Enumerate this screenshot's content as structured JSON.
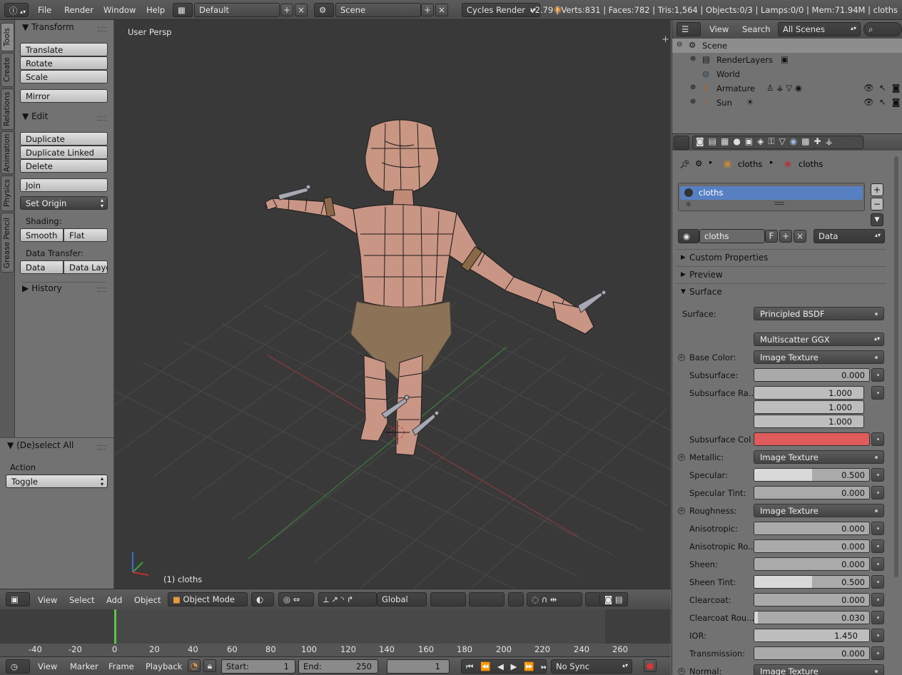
{
  "topbar": {
    "menus": [
      "File",
      "Render",
      "Window",
      "Help"
    ],
    "layout": "Default",
    "scene": "Scene",
    "engine": "Cycles Render",
    "stats": "v2.79 | Verts:831 | Faces:782 | Tris:1,564 | Objects:0/3 | Lamps:0/0 | Mem:71.94M | cloths"
  },
  "tabs": [
    "Tools",
    "Create",
    "Relations",
    "Animation",
    "Physics",
    "Grease Pencil"
  ],
  "toolshelf": {
    "transform": {
      "title": "Transform",
      "buttons": [
        "Translate",
        "Rotate",
        "Scale",
        "Mirror"
      ]
    },
    "edit": {
      "title": "Edit",
      "buttons": [
        "Duplicate",
        "Duplicate Linked",
        "Delete",
        "Join"
      ],
      "set_origin": "Set Origin"
    },
    "shading": {
      "label": "Shading:",
      "smooth": "Smooth",
      "flat": "Flat"
    },
    "data_transfer": {
      "label": "Data Transfer:",
      "data": "Data",
      "data_layout": "Data Layo"
    },
    "history": "History"
  },
  "operator": {
    "title": "(De)select All",
    "action_label": "Action",
    "action_value": "Toggle"
  },
  "viewport": {
    "view_name": "User Persp",
    "object_label": "(1) cloths"
  },
  "vp_header": {
    "menus": [
      "View",
      "Select",
      "Add",
      "Object"
    ],
    "mode": "Object Mode",
    "orientation": "Global"
  },
  "timeline": {
    "ticks": [
      "-40",
      "-20",
      "0",
      "20",
      "40",
      "60",
      "80",
      "100",
      "120",
      "140",
      "160",
      "180",
      "200",
      "220",
      "240",
      "260"
    ],
    "menus": [
      "View",
      "Marker",
      "Frame",
      "Playback"
    ],
    "start_label": "Start:",
    "start": "1",
    "end_label": "End:",
    "end": "250",
    "current": "1",
    "sync": "No Sync"
  },
  "outliner": {
    "menus": [
      "View",
      "Search"
    ],
    "scenes_select": "All Scenes",
    "items": [
      {
        "label": "Scene"
      },
      {
        "label": "RenderLayers"
      },
      {
        "label": "World"
      },
      {
        "label": "Armature"
      },
      {
        "label": "Sun"
      }
    ]
  },
  "properties": {
    "breadcrumb": [
      "cloths",
      "cloths"
    ],
    "slot_name": "cloths",
    "material_name": "cloths",
    "fake_user": "F",
    "link": "Data",
    "sections": {
      "custom": "Custom Properties",
      "preview": "Preview",
      "surface": "Surface"
    },
    "surface_label": "Surface:",
    "surface_value": "Principled BSDF",
    "distribution": "Multiscatter GGX",
    "rows": [
      {
        "label": "Base Color:",
        "type": "node",
        "value": "Image Texture"
      },
      {
        "label": "Subsurface:",
        "type": "slider",
        "value": "0.000",
        "fraction": 0.0
      },
      {
        "label": "Subsurface Ra...",
        "type": "vector",
        "values": [
          "1.000",
          "1.000",
          "1.000"
        ]
      },
      {
        "label": "Subsurface Col",
        "type": "color",
        "color": "#e05b5b"
      },
      {
        "label": "Metallic:",
        "type": "node",
        "value": "Image Texture"
      },
      {
        "label": "Specular:",
        "type": "slider",
        "value": "0.500",
        "fraction": 0.5
      },
      {
        "label": "Specular Tint:",
        "type": "slider",
        "value": "0.000",
        "fraction": 0.0
      },
      {
        "label": "Roughness:",
        "type": "node",
        "value": "Image Texture"
      },
      {
        "label": "Anisotropic:",
        "type": "slider",
        "value": "0.000",
        "fraction": 0.0
      },
      {
        "label": "Anisotropic Ro...",
        "type": "slider",
        "value": "0.000",
        "fraction": 0.0
      },
      {
        "label": "Sheen:",
        "type": "slider",
        "value": "0.000",
        "fraction": 0.0
      },
      {
        "label": "Sheen Tint:",
        "type": "slider",
        "value": "0.500",
        "fraction": 0.5
      },
      {
        "label": "Clearcoat:",
        "type": "slider",
        "value": "0.000",
        "fraction": 0.0
      },
      {
        "label": "Clearcoat Rou...",
        "type": "slider",
        "value": "0.030",
        "fraction": 0.03
      },
      {
        "label": "IOR:",
        "type": "number",
        "value": "1.450"
      },
      {
        "label": "Transmission:",
        "type": "slider",
        "value": "0.000",
        "fraction": 0.0
      },
      {
        "label": "Normal:",
        "type": "node",
        "value": "Image Texture"
      }
    ]
  }
}
